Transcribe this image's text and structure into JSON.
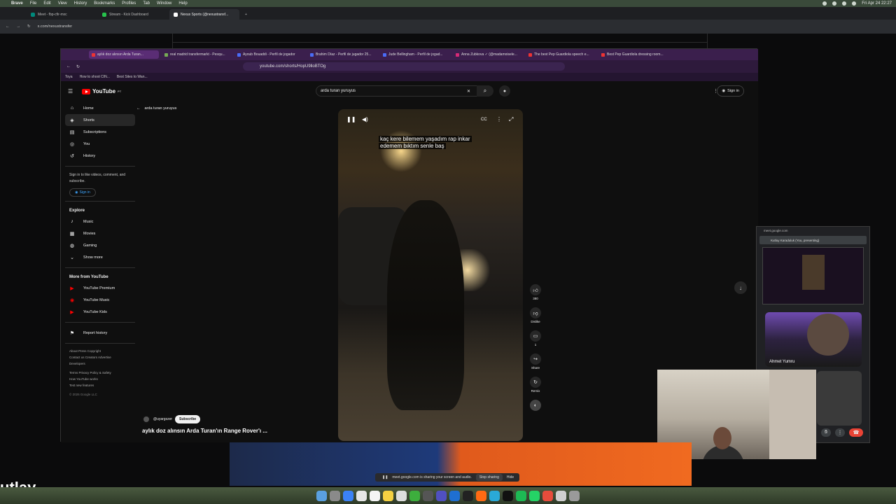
{
  "menubar": {
    "app": "Brave",
    "items": [
      "File",
      "Edit",
      "View",
      "History",
      "Bookmarks",
      "Profiles",
      "Tab",
      "Window",
      "Help"
    ],
    "datetime": "Fri Apr 24  22:27"
  },
  "outer_browser": {
    "tabs": [
      "Meet - fbp-cfir-mxc",
      "Stream - Kick Dashboard",
      "Nexus Sports (@nexustransf..."
    ],
    "url": "x.com/nexustransfer"
  },
  "inner_browser": {
    "tabs": [
      "aylık doz alınsın Arda Turan...",
      "real madrid transfermarkt - Pesqu...",
      "Ayoub Bouaddi - Perfil de jogador",
      "Brahim Díaz - Perfil de jugador 25...",
      "Jude Bellingham - Perfil de jogad...",
      "Anna Zubkova ✓ (@madamoisele...",
      "The best Pep Guardiola speech e...",
      "Best Pep Guardiola dressing room..."
    ],
    "url": "youtube.com/shorts/HopU9lloBTOg",
    "bookmarks": [
      "Toya",
      "How to shoot CIN...",
      "Best Sites to Wan..."
    ]
  },
  "youtube": {
    "logo": "YouTube",
    "country": "PT",
    "search_value": "arda turan yuruyus",
    "sign_in": "Sign in",
    "back_label": "arda turan yuruyus",
    "nav": [
      "Home",
      "Shorts",
      "Subscriptions",
      "You",
      "History"
    ],
    "signin_prompt": "Sign in to like videos, comment, and subscribe.",
    "signin_button": "Sign in",
    "explore_title": "Explore",
    "explore": [
      "Music",
      "Movies",
      "Gaming",
      "Show more"
    ],
    "more_title": "More from YouTube",
    "more": [
      "YouTube Premium",
      "YouTube Music",
      "YouTube Kids"
    ],
    "report": "Report history",
    "footer1": "About  Press  Copyright",
    "footer2": "Contact us  Creators  Advertise",
    "footer3": "Developers",
    "footer4": "Terms  Privacy  Policy & Safety",
    "footer5": "How YouTube works",
    "footer6": "Test new features",
    "copyright": "© 2026 Google LLC",
    "caption_line1": "kaç kere bilemem yaşadım rap inkar",
    "caption_line2": "edemem bıktım senle baş",
    "actions": {
      "like_count": "380",
      "dislike": "Dislike",
      "comments": "1",
      "share": "Share",
      "remix": "Remix"
    },
    "channel": "@uyargszer",
    "subscribe": "Subscribe",
    "video_title": "aylık doz alınsın  Arda Turan'ın Range Rover'ı ..."
  },
  "meet": {
    "url": "meet.google.com",
    "presenting": "Kutluy Karaduluk (You, presenting)",
    "participant": "Ahmet Yumru"
  },
  "share_bar": {
    "text": "meet.google.com is sharing your screen and audio.",
    "stop": "Stop sharing",
    "hide": "Hide"
  },
  "background_text": "utlay"
}
